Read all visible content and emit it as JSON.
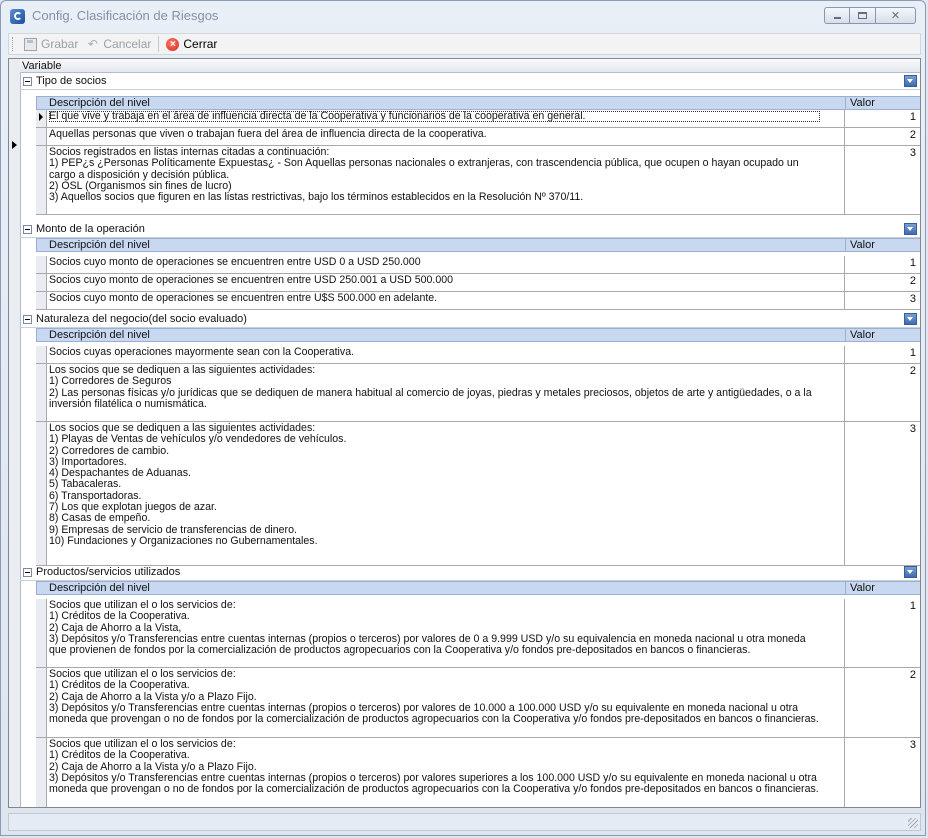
{
  "window": {
    "title": "Config. Clasificación de Riesgos",
    "controls": {
      "minimize": "minimize",
      "maximize": "maximize",
      "close": "✕"
    }
  },
  "toolbar": {
    "grabar_label": "Grabar",
    "cancelar_label": "Cancelar",
    "cerrar_label": "Cerrar"
  },
  "grid": {
    "variable_header": "Variable",
    "child_headers": {
      "descripcion": "Descripción del nivel",
      "valor": "Valor"
    },
    "sections": [
      {
        "title": "Tipo de socios",
        "rows": [
          {
            "descripcion": "El que vive y trabaja en el área de influencia directa de la Cooperativa y funcionarios de la cooperativa en general.",
            "valor": "1"
          },
          {
            "descripcion": "Aquellas personas que viven o trabajan fuera del área de influencia directa de la cooperativa.",
            "valor": "2"
          },
          {
            "descripcion": "Socios registrados en listas internas citadas a continuación:\n1) PEP¿s ¿Personas Políticamente Expuestas¿ - Son Aquellas personas nacionales o extranjeras, con trascendencia pública, que ocupen o hayan ocupado un cargo a disposición y decisión pública.\n2) OSL (Organismos sin fines de lucro)\n3) Aquellos socios que figuren en las listas restrictivas, bajo los términos establecidos en la Resolución Nº 370/11.",
            "valor": "3"
          }
        ]
      },
      {
        "title": "Monto de la operación",
        "rows": [
          {
            "descripcion": "Socios cuyo monto de operaciones se encuentren entre USD 0 a USD 250.000",
            "valor": "1"
          },
          {
            "descripcion": "Socios cuyo monto de operaciones se encuentren entre USD 250.001 a USD 500.000",
            "valor": "2"
          },
          {
            "descripcion": "Socios cuyo monto de operaciones se encuentren entre U$S 500.000 en adelante.",
            "valor": "3"
          }
        ]
      },
      {
        "title": "Naturaleza del negocio(del socio evaluado)",
        "rows": [
          {
            "descripcion": "Socios cuyas operaciones mayormente sean con la Cooperativa.",
            "valor": "1"
          },
          {
            "descripcion": "Los socios que se dediquen a las siguientes actividades:\n1) Corredores de Seguros\n2) Las personas físicas y/o jurídicas que se dediquen de manera habitual al comercio de joyas, piedras y metales preciosos, objetos de arte y antigüedades, o a la inversión filatélica o numismática.",
            "valor": "2"
          },
          {
            "descripcion": "Los socios que se dediquen a las siguientes actividades:\n1) Playas de Ventas de vehículos y/o vendedores de vehículos.\n2) Corredores de cambio.\n3) Importadores.\n4) Despachantes de Aduanas.\n5) Tabacaleras.\n6) Transportadoras.\n7) Los que explotan juegos de azar.\n8) Casas de empeño.\n9) Empresas de servicio de transferencias de dinero.\n10) Fundaciones y Organizaciones no Gubernamentales.",
            "valor": "3"
          }
        ]
      },
      {
        "title": "Productos/servicios utilizados",
        "rows": [
          {
            "descripcion": "Socios que utilizan el o los servicios de:\n1) Créditos de la Cooperativa.\n2) Caja de Ahorro a la Vista,\n3) Depósitos y/o Transferencias entre cuentas internas (propios o terceros) por valores de 0 a 9.999 USD y/o su equivalencia en moneda nacional u otra moneda que provienen de fondos por la comercialización de productos agropecuarios con la Cooperativa y/o fondos pre-depositados en bancos o financieras.",
            "valor": "1"
          },
          {
            "descripcion": "Socios que utilizan el o los servicios de:\n1) Créditos de la Cooperativa.\n2) Caja de Ahorro a la Vista y/o a Plazo Fijo.\n3) Depósitos y/o Transferencias entre cuentas internas (propios o terceros) por valores de 10.000 a 100.000 USD y/o su equivalente en moneda nacional u otra moneda que provengan o no de fondos por la comercialización de productos agropecuarios con la Cooperativa y/o fondos pre-depositados en bancos o financieras.",
            "valor": "2"
          },
          {
            "descripcion": "Socios que utilizan el o los servicios de:\n1) Créditos de la Cooperativa.\n2) Caja de Ahorro a la Vista y/o a Plazo Fijo.\n3) Depósitos y/o Transferencias entre cuentas internas (propios o terceros) por valores superiores a los 100.000 USD y/o su equivalente en moneda nacional u otra moneda que provengan o no de fondos por la comercialización de productos agropecuarios con la Cooperativa y/o fondos pre-depositados en bancos o financieras.",
            "valor": "3"
          }
        ]
      }
    ]
  }
}
